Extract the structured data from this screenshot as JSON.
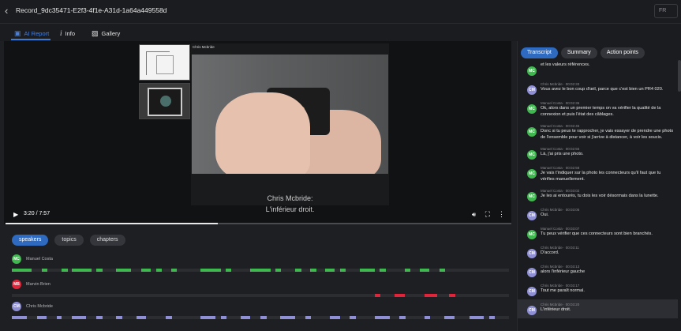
{
  "header": {
    "back_icon": "chevron-left-icon",
    "title": "Record_9dc35471-E2f3-4f1e-A31d-1a64a449558d",
    "lang": "FR"
  },
  "tabs": [
    {
      "label": "AI Report",
      "icon": "ai-report-icon",
      "active": true
    },
    {
      "label": "Info",
      "icon": "info-icon",
      "active": false
    },
    {
      "label": "Gallery",
      "icon": "gallery-icon",
      "active": false
    }
  ],
  "video": {
    "camera_name": "Chris Mcbride",
    "subtitle_speaker": "Chris Mcbride:",
    "subtitle_text": "L'inférieur droit.",
    "time": "3:20 / 7:57",
    "progress": 0.42
  },
  "timeline_tabs": [
    {
      "label": "speakers",
      "active": true
    },
    {
      "label": "topics",
      "active": false
    },
    {
      "label": "chapters",
      "active": false
    }
  ],
  "speakers": [
    {
      "initials": "MC",
      "name": "Manuel Costa",
      "color": "#3fb84f"
    },
    {
      "initials": "MB",
      "name": "Marvin Brien",
      "color": "#e0253a"
    },
    {
      "initials": "CM",
      "name": "Chris Mcbride",
      "color": "#8f8fd6"
    }
  ],
  "transcript_tabs": [
    {
      "label": "Transcript",
      "active": true
    },
    {
      "label": "Summary",
      "active": false
    },
    {
      "label": "Action points",
      "active": false
    }
  ],
  "transcript": [
    {
      "initials": "MC",
      "color": "#3fb84f",
      "meta": "",
      "text": "et les valeurs références."
    },
    {
      "initials": "CM",
      "color": "#8f8fd6",
      "meta": "Chris Mcbride · 00:02:33",
      "text": "Vous avez le bon coup d'œil, parce que c'est bien un PR4 020."
    },
    {
      "initials": "MC",
      "color": "#3fb84f",
      "meta": "Manuel Costa · 00:02:36",
      "text": "Ok, alors dans un premier temps on va vérifier la qualité de la connexion et puis l'état des câblages."
    },
    {
      "initials": "MC",
      "color": "#3fb84f",
      "meta": "Manuel Costa · 00:02:45",
      "text": "Donc si tu peux te rapprocher, je vais essayer de prendre une photo de l'ensemble pour voir si j'arrive à distancer, à voir les soucis."
    },
    {
      "initials": "MC",
      "color": "#3fb84f",
      "meta": "Manuel Costa · 00:02:55",
      "text": "Là, j'ai pris une photo."
    },
    {
      "initials": "MC",
      "color": "#3fb84f",
      "meta": "Manuel Costa · 00:02:58",
      "text": "Je vais t'indiquer sur la photo les connecteurs qu'il faut que tu vérifies manuellement."
    },
    {
      "initials": "MC",
      "color": "#3fb84f",
      "meta": "Manuel Costa · 00:03:02",
      "text": "Je les ai entourés, tu dois les voir désormais dans la lunette."
    },
    {
      "initials": "CM",
      "color": "#8f8fd6",
      "meta": "Chris Mcbride · 00:03:05",
      "text": "Oui."
    },
    {
      "initials": "MC",
      "color": "#3fb84f",
      "meta": "Manuel Costa · 00:03:07",
      "text": "Tu peux vérifier que ces connecteurs sont bien branchés."
    },
    {
      "initials": "CM",
      "color": "#8f8fd6",
      "meta": "Chris Mcbride · 00:03:11",
      "text": "D'accord."
    },
    {
      "initials": "CM",
      "color": "#8f8fd6",
      "meta": "Chris Mcbride · 00:03:13",
      "text": "alors l'inférieur gauche"
    },
    {
      "initials": "CM",
      "color": "#8f8fd6",
      "meta": "Chris Mcbride · 00:03:17",
      "text": "Tout me paraît normal."
    },
    {
      "initials": "CM",
      "color": "#8f8fd6",
      "meta": "Chris Mcbride · 00:03:20",
      "text": "L'inférieur droit.",
      "highlight": true
    }
  ]
}
